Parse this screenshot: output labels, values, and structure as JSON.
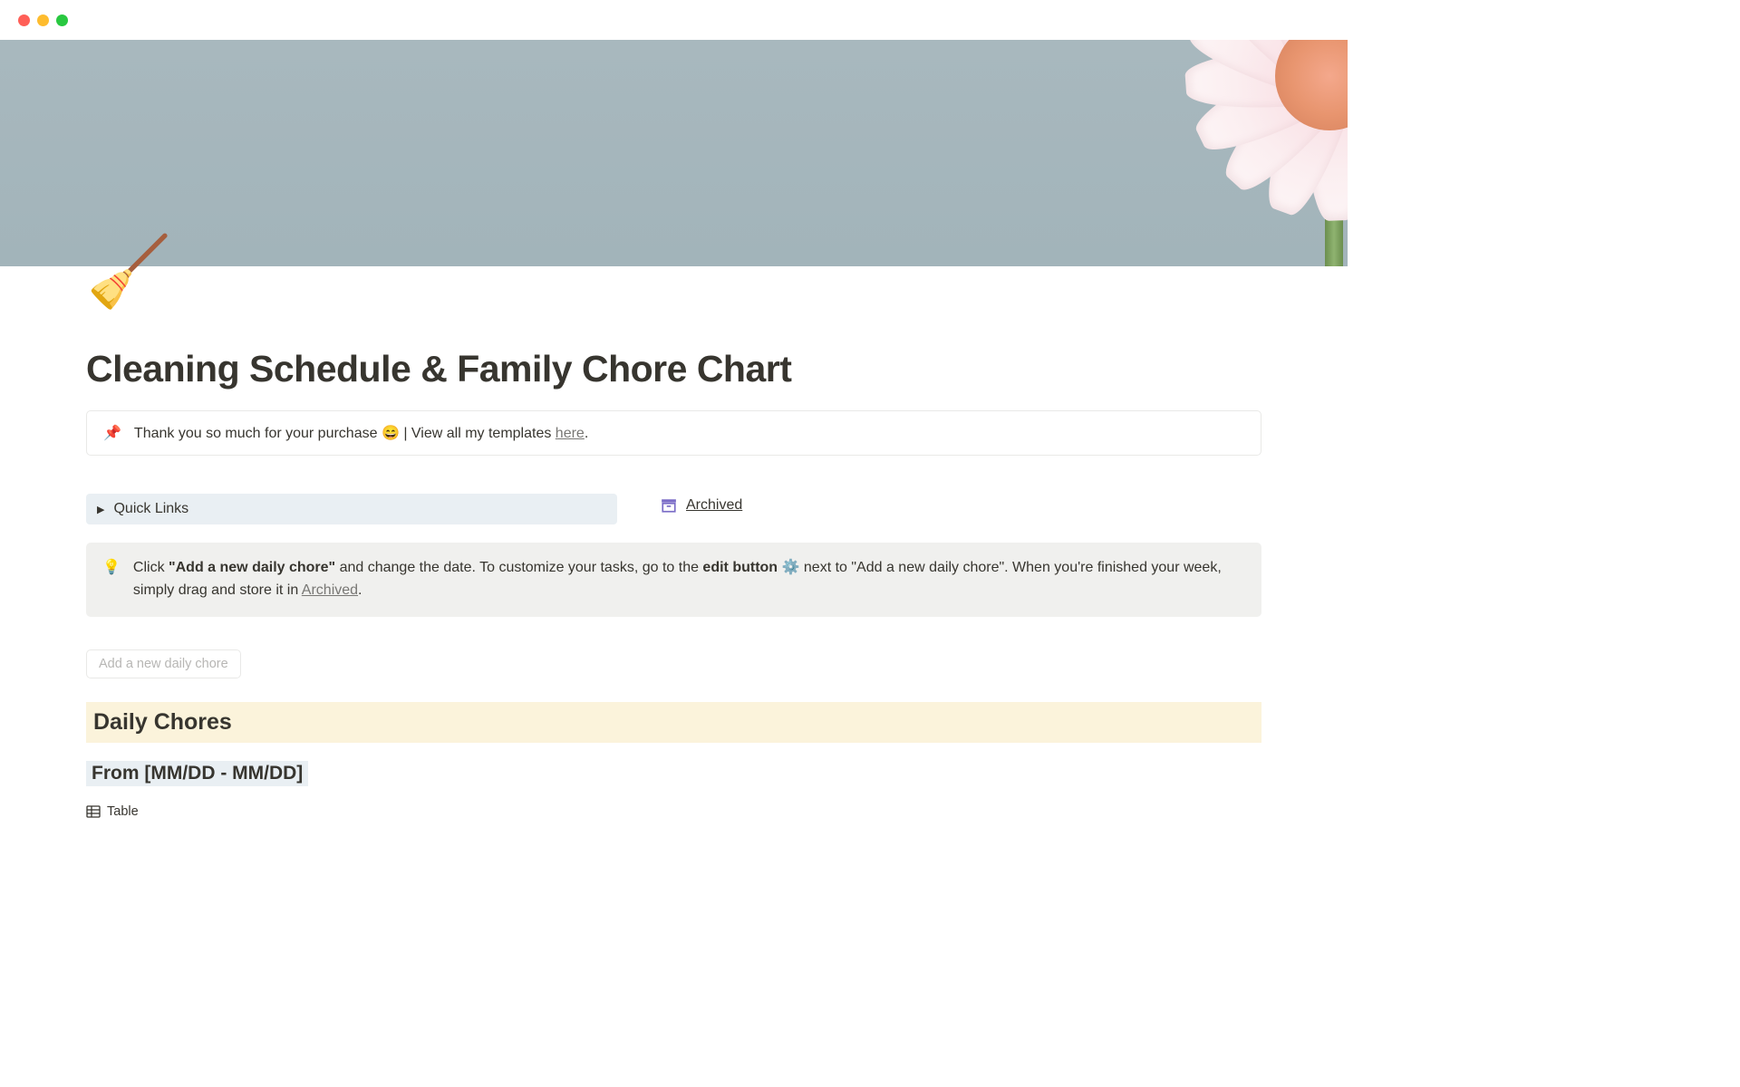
{
  "page": {
    "icon": "🧹",
    "title": "Cleaning Schedule & Family Chore Chart"
  },
  "callout_pin": {
    "icon": "📌",
    "text_before": "Thank you so much for your purchase 😄 | View all my templates ",
    "link_text": "here",
    "text_after": "."
  },
  "quick_links": {
    "label": "Quick Links"
  },
  "archived": {
    "label": "Archived"
  },
  "callout_tip": {
    "icon": "💡",
    "parts": {
      "t1": "Click ",
      "bold1": "\"Add a new daily chore\"",
      "t2": " and change the date. To customize your tasks, go to the",
      "bold2": " edit button",
      "t3": " ⚙️ next to \"Add a new daily chore\". When you're finished your week, simply drag and store it in ",
      "link": "Archived",
      "t4": "."
    }
  },
  "add_button": {
    "label": "Add a new daily chore"
  },
  "daily_chores": {
    "heading": "Daily Chores",
    "date_range": "From [MM/DD - MM/DD]",
    "view_tab": "Table"
  }
}
